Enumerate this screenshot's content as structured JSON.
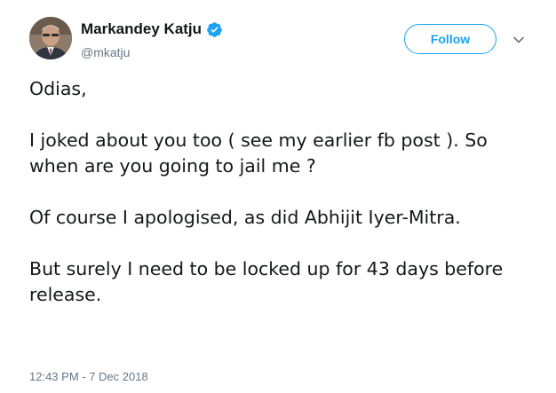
{
  "user": {
    "name": "Markandey Katju",
    "handle": "@mkatju",
    "verified": true
  },
  "follow_button": {
    "label": "Follow"
  },
  "tweet": {
    "paragraphs": [
      "Odias,",
      "I joked about you too ( see my earlier fb post ). So when are you going to jail me ?",
      "Of course I apologised, as did Abhijit Iyer-Mitra.",
      "But surely I need to be locked up for 43 days before release."
    ],
    "timestamp": "12:43 PM - 7 Dec 2018"
  },
  "colors": {
    "accent": "#1da1f2",
    "text": "#14171a",
    "muted": "#657786"
  },
  "icons": {
    "verified": "verified-badge-icon",
    "more": "chevron-down-icon"
  }
}
